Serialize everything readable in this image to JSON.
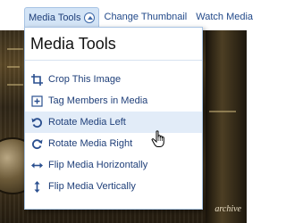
{
  "tabs": {
    "media_tools": "Media Tools",
    "change_thumbnail": "Change Thumbnail",
    "watch_media": "Watch Media"
  },
  "menu": {
    "title": "Media Tools",
    "items": [
      {
        "label": "Crop This Image",
        "icon": "crop-icon"
      },
      {
        "label": "Tag Members in Media",
        "icon": "tag-members-icon"
      },
      {
        "label": "Rotate Media Left",
        "icon": "rotate-left-icon"
      },
      {
        "label": "Rotate Media Right",
        "icon": "rotate-right-icon"
      },
      {
        "label": "Flip Media Horizontally",
        "icon": "flip-horizontal-icon"
      },
      {
        "label": "Flip Media Vertically",
        "icon": "flip-vertical-icon"
      }
    ],
    "hovered_item": "Rotate Media Left"
  },
  "photo": {
    "caption": "archive",
    "watermark": "/"
  },
  "colors": {
    "link": "#234a8a",
    "menu_border": "#a7c3e4",
    "hover_bg": "#e2ecf8"
  }
}
